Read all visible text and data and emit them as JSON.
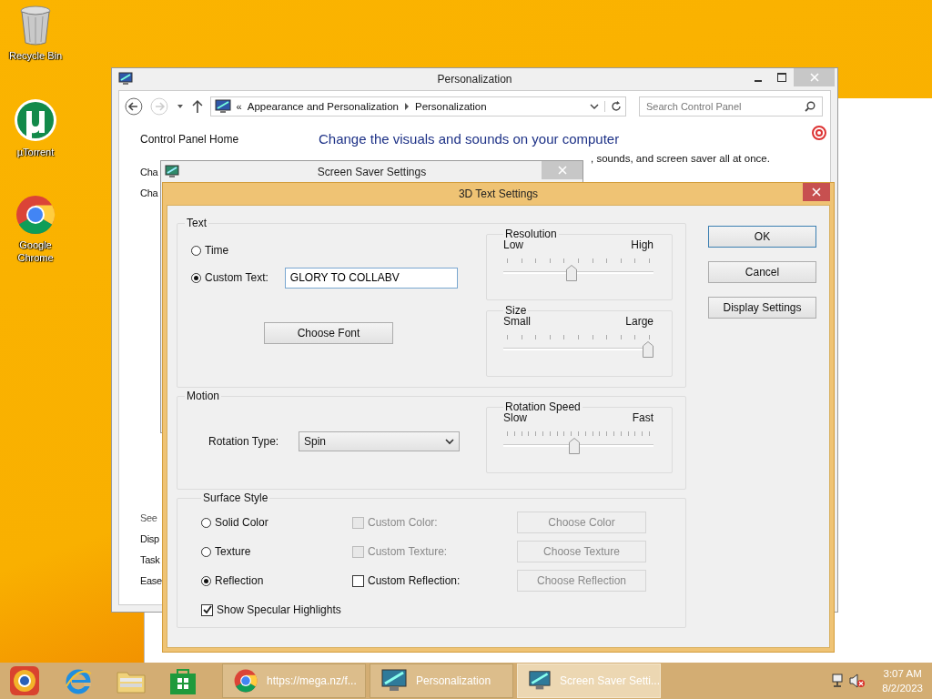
{
  "desktop_icons": [
    {
      "kind": "recycle",
      "label": "Recycle Bin"
    },
    {
      "kind": "torrent",
      "label": "µTorrent"
    },
    {
      "kind": "chrome",
      "label": "Google Chrome"
    }
  ],
  "personalization": {
    "title": "Personalization",
    "address_overflow": "«",
    "breadcrumb": [
      "Appearance and Personalization",
      "Personalization"
    ],
    "search": {
      "placeholder": "Search Control Panel"
    },
    "sidebar": {
      "home": "Control Panel Home",
      "links": [
        "Cha",
        "Cha"
      ],
      "see_also": "See",
      "see_links": [
        "Disp",
        "Task",
        "Ease"
      ]
    },
    "heading": "Change the visuals and sounds on your computer",
    "intro": ", sounds, and screen saver all at once."
  },
  "screen_saver": {
    "title": "Screen Saver Settings"
  },
  "dialog": {
    "title": "3D Text Settings",
    "text_group": {
      "title": "Text",
      "options": [
        {
          "label": "Time",
          "selected": false
        },
        {
          "label": "Custom Text:",
          "selected": true
        }
      ],
      "custom_text": "GLORY TO COLLABV",
      "choose_font": "Choose Font"
    },
    "resolution": {
      "title": "Resolution",
      "min_label": "Low",
      "max_label": "High",
      "level": 0.45
    },
    "size": {
      "title": "Size",
      "min_label": "Small",
      "max_label": "Large",
      "level": 1.0
    },
    "motion": {
      "title": "Motion",
      "rotation_type_label": "Rotation Type:",
      "rotation_type": "Spin"
    },
    "rotation_speed": {
      "title": "Rotation Speed",
      "min_label": "Slow",
      "max_label": "Fast",
      "level": 0.47
    },
    "surface": {
      "title": "Surface Style",
      "options": [
        {
          "label": "Solid Color",
          "selected": false,
          "check": {
            "label": "Custom Color:",
            "checked": false,
            "disabled": true
          },
          "button": {
            "label": "Choose Color",
            "disabled": true
          }
        },
        {
          "label": "Texture",
          "selected": false,
          "check": {
            "label": "Custom Texture:",
            "checked": false,
            "disabled": true
          },
          "button": {
            "label": "Choose Texture",
            "disabled": true
          }
        },
        {
          "label": "Reflection",
          "selected": true,
          "check": {
            "label": "Custom Reflection:",
            "checked": false,
            "disabled": false
          },
          "button": {
            "label": "Choose Reflection",
            "disabled": true
          }
        }
      ],
      "highlights": {
        "label": "Show Specular Highlights",
        "checked": true
      }
    },
    "buttons": [
      {
        "label": "OK",
        "default": true
      },
      {
        "label": "Cancel",
        "default": false
      },
      {
        "label": "Display Settings",
        "default": false
      }
    ]
  },
  "taskbar": {
    "tasks": [
      {
        "kind": "chrome",
        "label": "https://mega.nz/f...",
        "selected": false
      },
      {
        "kind": "control",
        "label": "Personalization",
        "selected": false
      },
      {
        "kind": "control",
        "label": "Screen Saver Setti...",
        "selected": true
      }
    ],
    "time": "3:07 AM",
    "date": "8/2/2023"
  }
}
